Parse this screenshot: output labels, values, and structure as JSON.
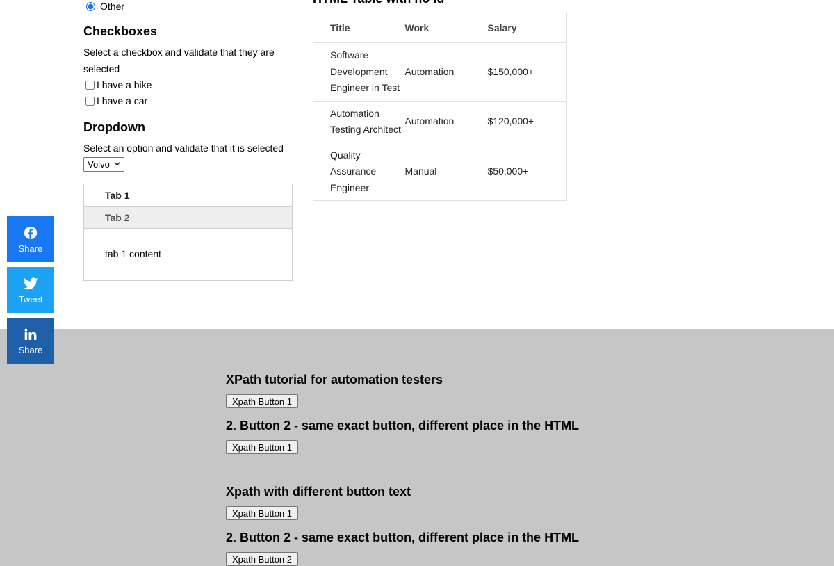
{
  "radio": {
    "other_label": "Other"
  },
  "checkboxes": {
    "heading": "Checkboxes",
    "description": "Select a checkbox and validate that they are selected",
    "items": [
      {
        "label": "I have a bike",
        "checked": false
      },
      {
        "label": "I have a car",
        "checked": false
      }
    ]
  },
  "dropdown": {
    "heading": "Dropdown",
    "description": "Select an option and validate that it is selected",
    "selected": "Volvo"
  },
  "tabs": {
    "items": [
      {
        "label": "Tab 1"
      },
      {
        "label": "Tab 2"
      }
    ],
    "content": "tab 1 content"
  },
  "table": {
    "title": "HTML Table with no id",
    "headers": [
      "Title",
      "Work",
      "Salary"
    ],
    "rows": [
      {
        "title": "Software Development Engineer in Test",
        "work": "Automation",
        "salary": "$150,000+"
      },
      {
        "title": "Automation Testing Architect",
        "work": "Automation",
        "salary": "$120,000+"
      },
      {
        "title": "Quality Assurance Engineer",
        "work": "Manual",
        "salary": "$50,000+"
      }
    ]
  },
  "social": {
    "facebook": {
      "label": "Share",
      "icon": "facebook-icon",
      "color": "#1877f2"
    },
    "twitter": {
      "label": "Tweet",
      "icon": "twitter-icon",
      "color": "#1da1f2"
    },
    "linkedin": {
      "label": "Share",
      "icon": "linkedin-icon",
      "color": "#1f5fa9"
    }
  },
  "xpath": {
    "heading1": "XPath tutorial for automation testers",
    "button1": "Xpath Button 1",
    "heading2": "2. Button 2 - same exact button, different place in the HTML",
    "button2": "Xpath Button 1",
    "heading3": "Xpath with different button text",
    "button3": "Xpath Button 1",
    "heading4": "2. Button 2 - same exact button, different place in the HTML",
    "button4": "Xpath Button 2"
  }
}
